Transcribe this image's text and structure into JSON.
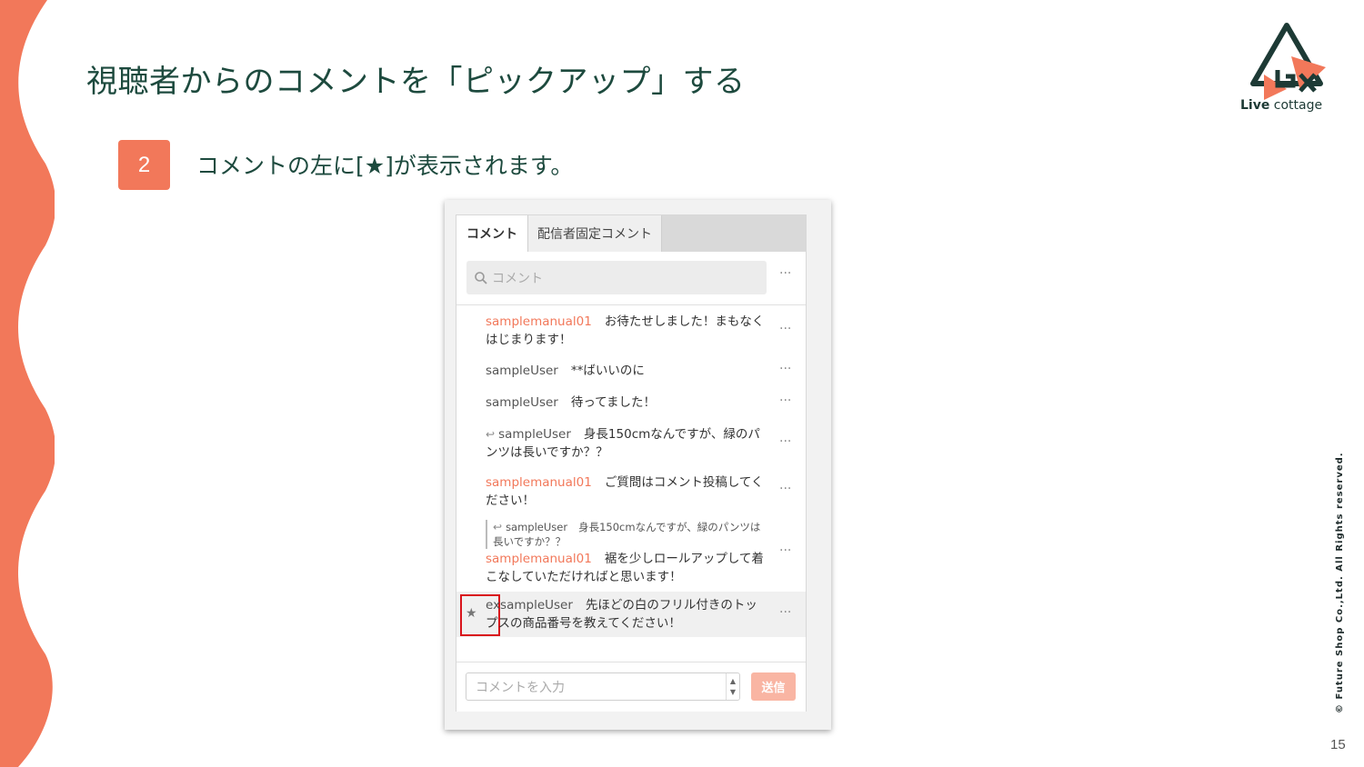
{
  "slide": {
    "title": "視聴者からのコメントを「ピックアップ」する",
    "step_number": "2",
    "step_text": "コメントの左に[★]が表示されます。",
    "copyright": "© Future Shop Co.,Ltd. All Rights reserved.",
    "page_number": "15",
    "logo_bold": "Live",
    "logo_light": "cottage"
  },
  "colors": {
    "accent": "#f2785a",
    "title": "#1d4a3e",
    "highlight_box": "#d9141c"
  },
  "panel": {
    "tabs": [
      {
        "label": "コメント",
        "active": true
      },
      {
        "label": "配信者固定コメント",
        "active": false
      }
    ],
    "search_placeholder": "コメント",
    "more_label": "···",
    "comments": [
      {
        "user": "samplemanual01",
        "text": "お待たせしました！まもなくはじまります！",
        "moderator": true
      },
      {
        "user": "sampleUser",
        "text": "**ばいいのに",
        "moderator": false
      },
      {
        "user": "sampleUser",
        "text": "待ってました！",
        "moderator": false
      },
      {
        "user": "sampleUser",
        "text": "身長150cmなんですが、緑のパンツは長いですか？？",
        "moderator": false,
        "reply_icon": "reply-icon"
      },
      {
        "user": "samplemanual01",
        "text": "ご質問はコメント投稿してください！",
        "moderator": true
      },
      {
        "quote_user": "sampleUser",
        "quote_text": "身長150cmなんですが、緑のパンツは長いですか？？",
        "user": "samplemanual01",
        "text": "裾を少しロールアップして着こなしていただければと思います！",
        "moderator": true
      },
      {
        "user": "exsampleUser",
        "text": "先ほどの白のフリル付きのトップスの商品番号を教えてください！",
        "moderator": false,
        "star": "★"
      }
    ],
    "input_placeholder": "コメントを入力",
    "send_label": "送信"
  }
}
